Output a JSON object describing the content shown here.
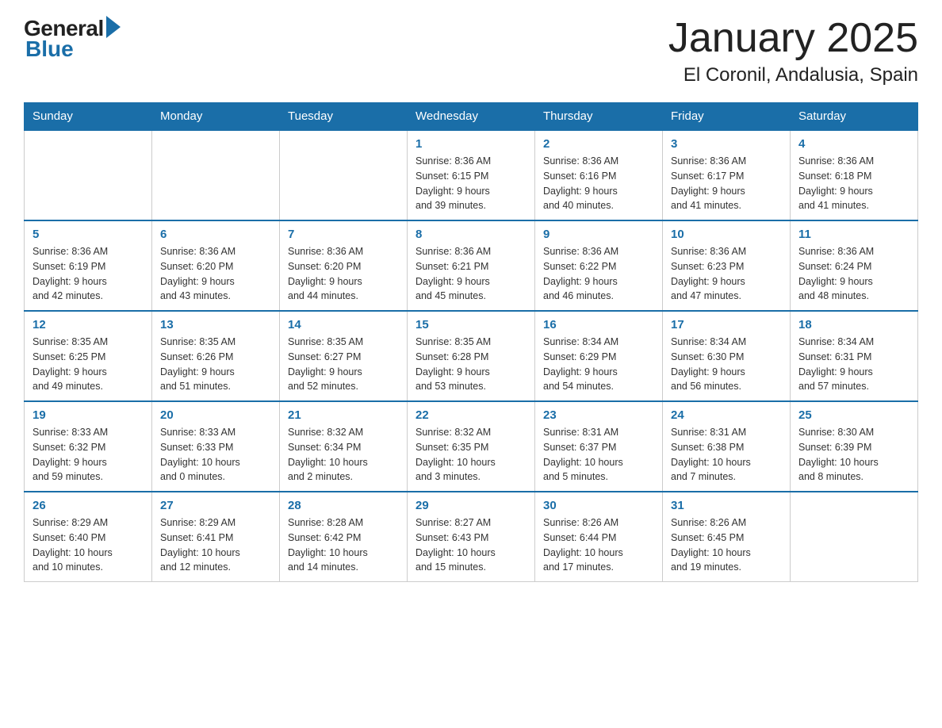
{
  "header": {
    "logo_general": "General",
    "logo_blue": "Blue",
    "month_title": "January 2025",
    "location": "El Coronil, Andalusia, Spain"
  },
  "days_of_week": [
    "Sunday",
    "Monday",
    "Tuesday",
    "Wednesday",
    "Thursday",
    "Friday",
    "Saturday"
  ],
  "weeks": [
    [
      {
        "day": "",
        "info": ""
      },
      {
        "day": "",
        "info": ""
      },
      {
        "day": "",
        "info": ""
      },
      {
        "day": "1",
        "info": "Sunrise: 8:36 AM\nSunset: 6:15 PM\nDaylight: 9 hours\nand 39 minutes."
      },
      {
        "day": "2",
        "info": "Sunrise: 8:36 AM\nSunset: 6:16 PM\nDaylight: 9 hours\nand 40 minutes."
      },
      {
        "day": "3",
        "info": "Sunrise: 8:36 AM\nSunset: 6:17 PM\nDaylight: 9 hours\nand 41 minutes."
      },
      {
        "day": "4",
        "info": "Sunrise: 8:36 AM\nSunset: 6:18 PM\nDaylight: 9 hours\nand 41 minutes."
      }
    ],
    [
      {
        "day": "5",
        "info": "Sunrise: 8:36 AM\nSunset: 6:19 PM\nDaylight: 9 hours\nand 42 minutes."
      },
      {
        "day": "6",
        "info": "Sunrise: 8:36 AM\nSunset: 6:20 PM\nDaylight: 9 hours\nand 43 minutes."
      },
      {
        "day": "7",
        "info": "Sunrise: 8:36 AM\nSunset: 6:20 PM\nDaylight: 9 hours\nand 44 minutes."
      },
      {
        "day": "8",
        "info": "Sunrise: 8:36 AM\nSunset: 6:21 PM\nDaylight: 9 hours\nand 45 minutes."
      },
      {
        "day": "9",
        "info": "Sunrise: 8:36 AM\nSunset: 6:22 PM\nDaylight: 9 hours\nand 46 minutes."
      },
      {
        "day": "10",
        "info": "Sunrise: 8:36 AM\nSunset: 6:23 PM\nDaylight: 9 hours\nand 47 minutes."
      },
      {
        "day": "11",
        "info": "Sunrise: 8:36 AM\nSunset: 6:24 PM\nDaylight: 9 hours\nand 48 minutes."
      }
    ],
    [
      {
        "day": "12",
        "info": "Sunrise: 8:35 AM\nSunset: 6:25 PM\nDaylight: 9 hours\nand 49 minutes."
      },
      {
        "day": "13",
        "info": "Sunrise: 8:35 AM\nSunset: 6:26 PM\nDaylight: 9 hours\nand 51 minutes."
      },
      {
        "day": "14",
        "info": "Sunrise: 8:35 AM\nSunset: 6:27 PM\nDaylight: 9 hours\nand 52 minutes."
      },
      {
        "day": "15",
        "info": "Sunrise: 8:35 AM\nSunset: 6:28 PM\nDaylight: 9 hours\nand 53 minutes."
      },
      {
        "day": "16",
        "info": "Sunrise: 8:34 AM\nSunset: 6:29 PM\nDaylight: 9 hours\nand 54 minutes."
      },
      {
        "day": "17",
        "info": "Sunrise: 8:34 AM\nSunset: 6:30 PM\nDaylight: 9 hours\nand 56 minutes."
      },
      {
        "day": "18",
        "info": "Sunrise: 8:34 AM\nSunset: 6:31 PM\nDaylight: 9 hours\nand 57 minutes."
      }
    ],
    [
      {
        "day": "19",
        "info": "Sunrise: 8:33 AM\nSunset: 6:32 PM\nDaylight: 9 hours\nand 59 minutes."
      },
      {
        "day": "20",
        "info": "Sunrise: 8:33 AM\nSunset: 6:33 PM\nDaylight: 10 hours\nand 0 minutes."
      },
      {
        "day": "21",
        "info": "Sunrise: 8:32 AM\nSunset: 6:34 PM\nDaylight: 10 hours\nand 2 minutes."
      },
      {
        "day": "22",
        "info": "Sunrise: 8:32 AM\nSunset: 6:35 PM\nDaylight: 10 hours\nand 3 minutes."
      },
      {
        "day": "23",
        "info": "Sunrise: 8:31 AM\nSunset: 6:37 PM\nDaylight: 10 hours\nand 5 minutes."
      },
      {
        "day": "24",
        "info": "Sunrise: 8:31 AM\nSunset: 6:38 PM\nDaylight: 10 hours\nand 7 minutes."
      },
      {
        "day": "25",
        "info": "Sunrise: 8:30 AM\nSunset: 6:39 PM\nDaylight: 10 hours\nand 8 minutes."
      }
    ],
    [
      {
        "day": "26",
        "info": "Sunrise: 8:29 AM\nSunset: 6:40 PM\nDaylight: 10 hours\nand 10 minutes."
      },
      {
        "day": "27",
        "info": "Sunrise: 8:29 AM\nSunset: 6:41 PM\nDaylight: 10 hours\nand 12 minutes."
      },
      {
        "day": "28",
        "info": "Sunrise: 8:28 AM\nSunset: 6:42 PM\nDaylight: 10 hours\nand 14 minutes."
      },
      {
        "day": "29",
        "info": "Sunrise: 8:27 AM\nSunset: 6:43 PM\nDaylight: 10 hours\nand 15 minutes."
      },
      {
        "day": "30",
        "info": "Sunrise: 8:26 AM\nSunset: 6:44 PM\nDaylight: 10 hours\nand 17 minutes."
      },
      {
        "day": "31",
        "info": "Sunrise: 8:26 AM\nSunset: 6:45 PM\nDaylight: 10 hours\nand 19 minutes."
      },
      {
        "day": "",
        "info": ""
      }
    ]
  ]
}
